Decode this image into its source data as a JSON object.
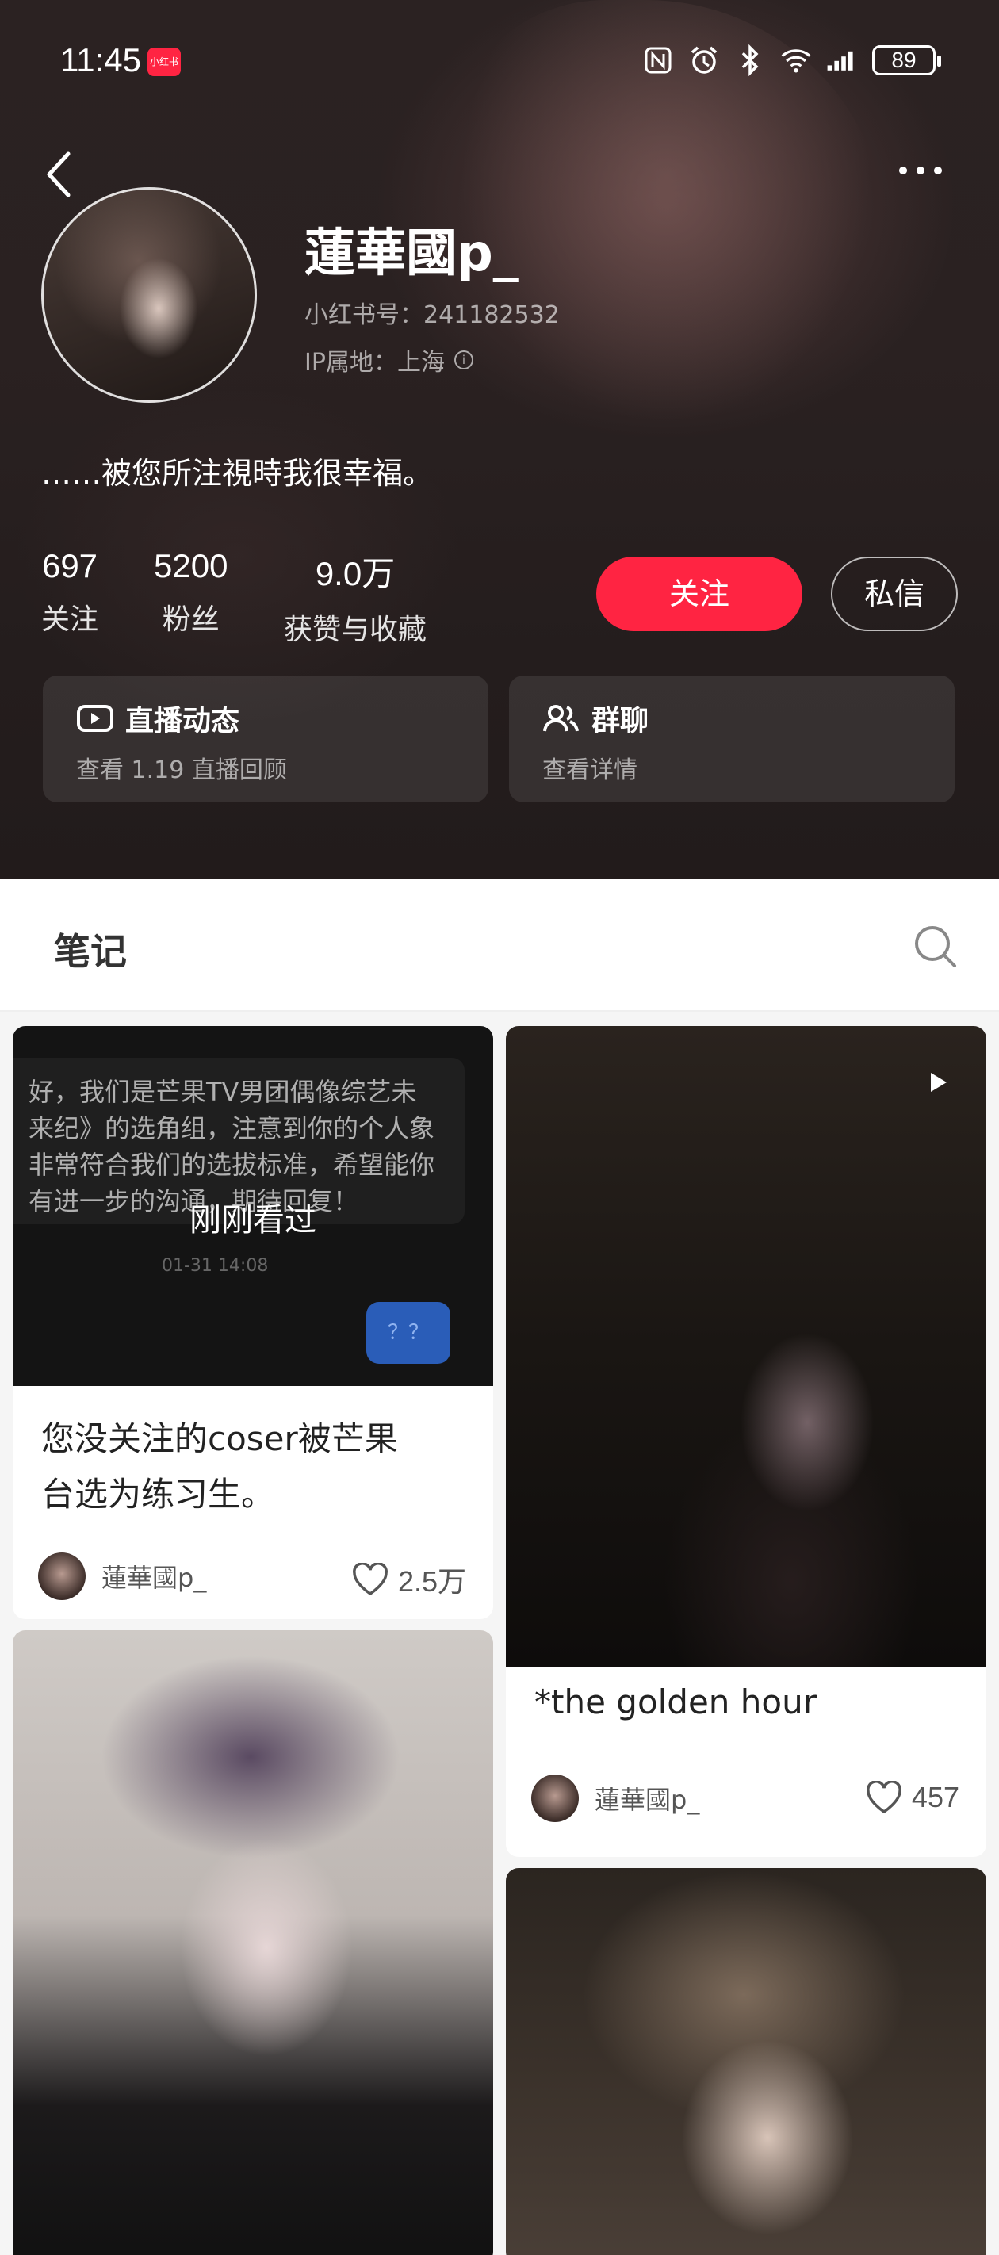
{
  "statusbar": {
    "time": "11:45",
    "app_badge": "小红书",
    "battery": "89",
    "icons": [
      "nfc-icon",
      "alarm-icon",
      "bluetooth-icon",
      "wifi-icon",
      "signal-icon"
    ]
  },
  "profile": {
    "username": "蓮華國p_",
    "red_id": "小红书号：241182532",
    "ip_location": "IP属地：上海",
    "bio": "……被您所注視時我很幸福。",
    "stats": [
      {
        "value": "697",
        "label": "关注"
      },
      {
        "value": "5200",
        "label": "粉丝"
      },
      {
        "value": "9.0万",
        "label": "获赞与收藏"
      }
    ],
    "follow_label": "关注",
    "message_label": "私信"
  },
  "cards": [
    {
      "title": "直播动态",
      "subtitle": "查看 1.19 直播回顾",
      "icon": "live-video-icon"
    },
    {
      "title": "群聊",
      "subtitle": "查看详情",
      "icon": "group-icon"
    }
  ],
  "notes_tab": "笔记",
  "notes": [
    {
      "title_line1": "您没关注的coser被芒果",
      "title_line2": "台选为练习生。",
      "author": "蓮華國p_",
      "likes": "2.5万",
      "seen": "刚刚看过",
      "chat_text": "好，我们是芒果TV男团偶像综艺未来纪》的选角组，注意到你的个人象非常符合我们的选拔标准，希望能你有进一步的沟通，期待回复！",
      "chat_time": "01-31 14:08",
      "chat_reply": "？？"
    },
    {
      "title": "*the golden hour",
      "author": "蓮華國p_",
      "likes": "457"
    }
  ]
}
